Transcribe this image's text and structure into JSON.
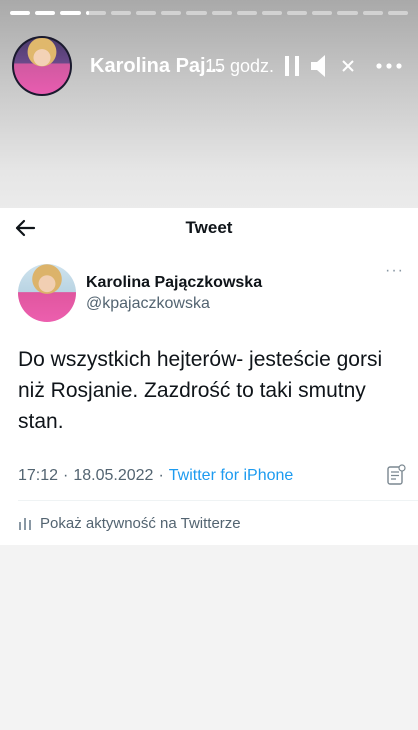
{
  "story": {
    "segments": [
      1,
      1,
      1,
      0.15,
      0,
      0,
      0,
      0,
      0,
      0,
      0,
      0,
      0,
      0,
      0,
      0
    ],
    "user_name": "Karolina Paj...",
    "time_ago": "15 godz.",
    "icons": [
      "pause-icon",
      "mute-icon",
      "close-icon",
      "more-icon"
    ]
  },
  "tweet": {
    "header_title": "Tweet",
    "author_name": "Karolina Pajączkowska",
    "author_handle": "@kpajaczkowska",
    "text": "Do wszystkich hejterów- jesteście gorsi niż Rosjanie. Zazdrość to taki smutny stan.",
    "time": "17:12",
    "separator": "·",
    "date": "18.05.2022",
    "source": "Twitter for iPhone",
    "analytics_label": "Pokaż aktywność na Twitterze",
    "more": "···"
  }
}
